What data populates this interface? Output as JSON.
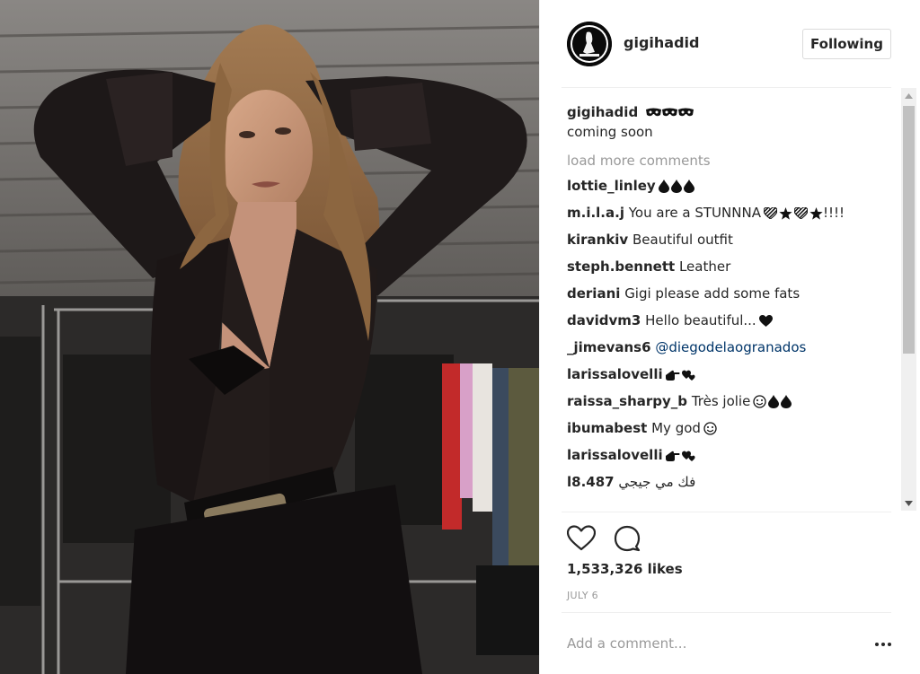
{
  "post": {
    "username": "gigihadid",
    "follow_label": "Following",
    "caption": {
      "username": "gigihadid",
      "emoji_icons": [
        "mask-icon",
        "mask-icon",
        "mask-icon"
      ],
      "text": "coming soon"
    },
    "load_more_label": "load more comments",
    "comments": [
      {
        "user": "lottie_linley",
        "text": "",
        "icons": [
          "drop-icon",
          "drop-icon",
          "drop-icon"
        ]
      },
      {
        "user": "m.i.l.a.j",
        "text": "You are a STUNNNA",
        "icons": [
          "heart-striped-icon",
          "star-icon",
          "heart-striped-icon",
          "star-icon"
        ],
        "suffix": "!!!!"
      },
      {
        "user": "kirankiv",
        "text": "Beautiful outfit",
        "icons": []
      },
      {
        "user": "steph.bennett",
        "text": "Leather",
        "icons": []
      },
      {
        "user": "deriani",
        "text": "Gigi please add some fats",
        "icons": []
      },
      {
        "user": "davidvm3",
        "text": "Hello beautiful...",
        "icons": [
          "heart-icon"
        ]
      },
      {
        "user": "_jimevans6",
        "text": "@diegodelaogranados",
        "icons": [],
        "mention": true
      },
      {
        "user": "larissalovelli",
        "text": "",
        "icons": [
          "pointing-hand-icon",
          "hearts-icon"
        ]
      },
      {
        "user": "raissa_sharpy_b",
        "text": "Très jolie",
        "icons": [
          "smile-icon",
          "drop-icon",
          "drop-icon"
        ]
      },
      {
        "user": "ibumabest",
        "text": "My god",
        "icons": [
          "smile-icon"
        ]
      },
      {
        "user": "larissalovelli",
        "text": "",
        "icons": [
          "pointing-hand-icon",
          "hearts-icon"
        ]
      },
      {
        "user": "l8.487",
        "text": "فك مي جيجي",
        "icons": []
      }
    ],
    "likes": "1,533,326 likes",
    "date": "JULY 6",
    "add_comment_placeholder": "Add a comment...",
    "colors": {
      "text": "#262626",
      "muted": "#999999",
      "mention": "#003569",
      "border": "#dbdbdb"
    }
  }
}
